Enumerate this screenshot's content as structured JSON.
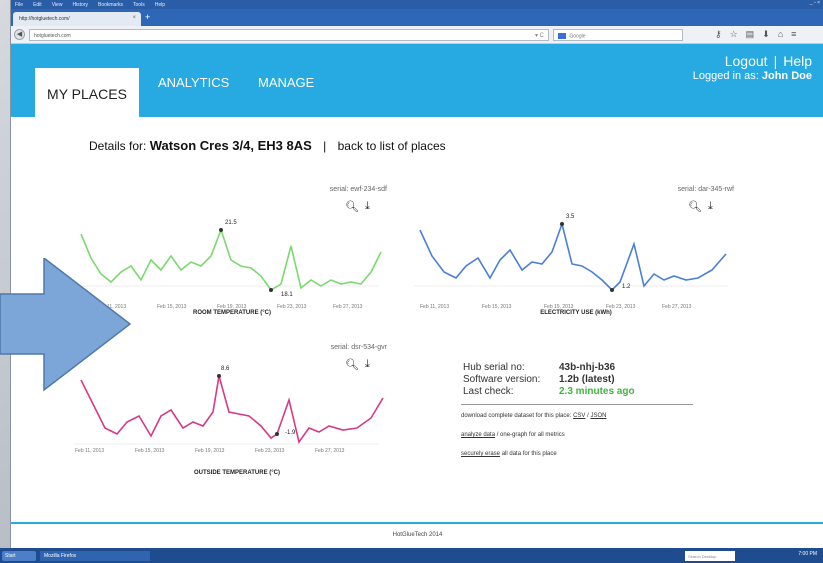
{
  "browser": {
    "menu": [
      "File",
      "Edit",
      "View",
      "History",
      "Bookmarks",
      "Tools",
      "Help"
    ],
    "tab_title": "http://hotgluetech.com/",
    "tab_close": "×",
    "new_tab": "+",
    "url": "hotgluetech.com",
    "search_placeholder": "Google",
    "window_controls": "_ ▫ ×",
    "nav_icon_names": [
      "key-icon",
      "star-icon",
      "bookmarks-icon",
      "download-icon",
      "home-icon",
      "menu-icon"
    ]
  },
  "header": {
    "tabs": [
      {
        "label": "MY PLACES",
        "active": true
      },
      {
        "label": "ANALYTICS",
        "active": false
      },
      {
        "label": "MANAGE",
        "active": false
      }
    ],
    "logout": "Logout",
    "sep": "|",
    "help": "Help",
    "logged_in_prefix": "Logged in as:",
    "user": "John Doe",
    "accent_color": "#27a9e1"
  },
  "details": {
    "prefix": "Details for:",
    "place": "Watson Cres 3/4, EH3 8AS",
    "sep": "|",
    "back_link": "back to list of places"
  },
  "charts": [
    {
      "serial": "serial: ewf-234-sdf",
      "title": "ROOM TEMPERATURE (°C)",
      "color": "#7bd96f",
      "dot_color": "#4bb84b",
      "ticks": [
        "Feb 11, 2013",
        "Feb 15, 2013",
        "Feb 19, 2013",
        "Feb 23, 2013",
        "Feb 27, 2013"
      ],
      "max_label": "21.5",
      "min_label": "18.1"
    },
    {
      "serial": "serial: dar-345-rwf",
      "title": "ELECTRICITY USE (kWh)",
      "color": "#4a7fd8",
      "dot_color": "#3366cc",
      "ticks": [
        "Feb 11, 2013",
        "Feb 15, 2013",
        "Feb 19, 2013",
        "Feb 23, 2013",
        "Feb 27, 2013"
      ],
      "max_label": "3.5",
      "min_label": "1.2"
    },
    {
      "serial": "serial: dsr-534-gvr",
      "title": "OUTSIDE TEMPERATURE (°C)",
      "color": "#d63a86",
      "dot_color": "#c02070",
      "ticks": [
        "Feb 11, 2013",
        "Feb 15, 2013",
        "Feb 19, 2013",
        "Feb 23, 2013",
        "Feb 27, 2013"
      ],
      "max_label": "8.6",
      "min_label": "-1.9"
    }
  ],
  "hub": {
    "serial_key": "Hub serial no:",
    "serial_val": "43b-nhj-b36",
    "software_key": "Software version:",
    "software_val": "1.2b (latest)",
    "last_check_key": "Last check:",
    "last_check_val": "2.3 minutes ago",
    "download_text": "download complete dataset for this place:",
    "csv": "CSV",
    "slash": "/",
    "json": "JSON",
    "analyze_link": "analyze data",
    "analyze_rest": "/ one-graph for all metrics",
    "erase_link": "securely erase",
    "erase_rest": "all data for this place"
  },
  "footer": {
    "text": "HotGlueTech 2014"
  },
  "taskbar": {
    "start": "Start",
    "app": "Mozilla Firefox",
    "search": "Search Desktop",
    "clock": "7:00 PM"
  }
}
